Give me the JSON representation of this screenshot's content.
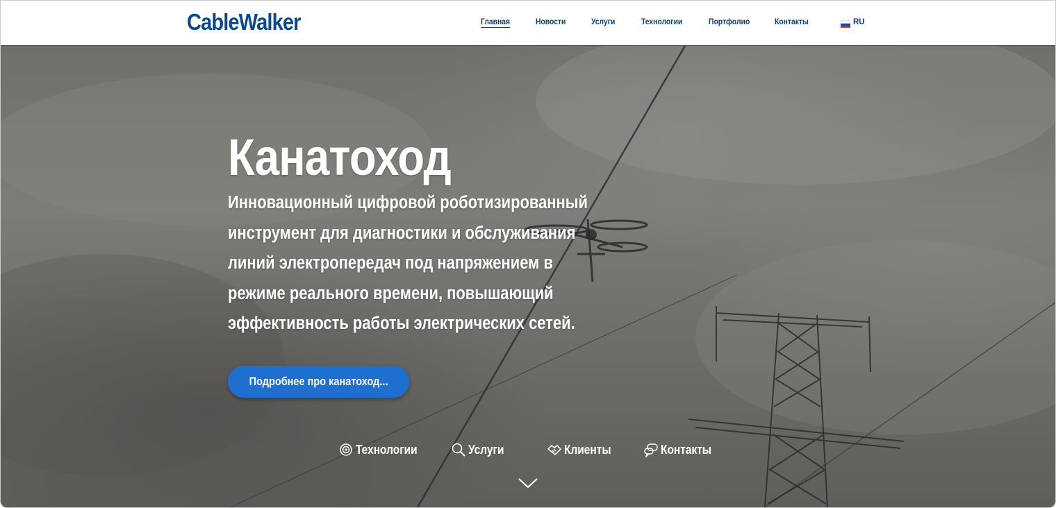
{
  "header": {
    "logo": "CableWalker",
    "nav": [
      {
        "label": "Главная",
        "active": true
      },
      {
        "label": "Новости"
      },
      {
        "label": "Услуги"
      },
      {
        "label": "Технологии"
      },
      {
        "label": "Портфолио"
      },
      {
        "label": "Контакты"
      }
    ],
    "language": {
      "label": "RU",
      "flag_icon": "russia-flag-icon"
    }
  },
  "hero": {
    "title": "Канатоход",
    "description": "Инновационный цифровой роботизированный инструмент для диагностики и обслуживания линий электропередач под напряжением в режиме реального времени, повышающий эффективность работы электрических сетей.",
    "cta_label": "Подробнее про канатоход...",
    "quick_links": [
      {
        "label": "Технологии",
        "icon": "gear-icon"
      },
      {
        "label": "Услуги",
        "icon": "search-icon"
      },
      {
        "label": "Клиенты",
        "icon": "handshake-icon"
      },
      {
        "label": "Контакты",
        "icon": "chat-icon"
      }
    ],
    "scroll_icon": "chevron-down-icon"
  },
  "colors": {
    "brand": "#0a4a8c",
    "nav_text": "#0b3f78",
    "cta": "#1f6fd0"
  }
}
